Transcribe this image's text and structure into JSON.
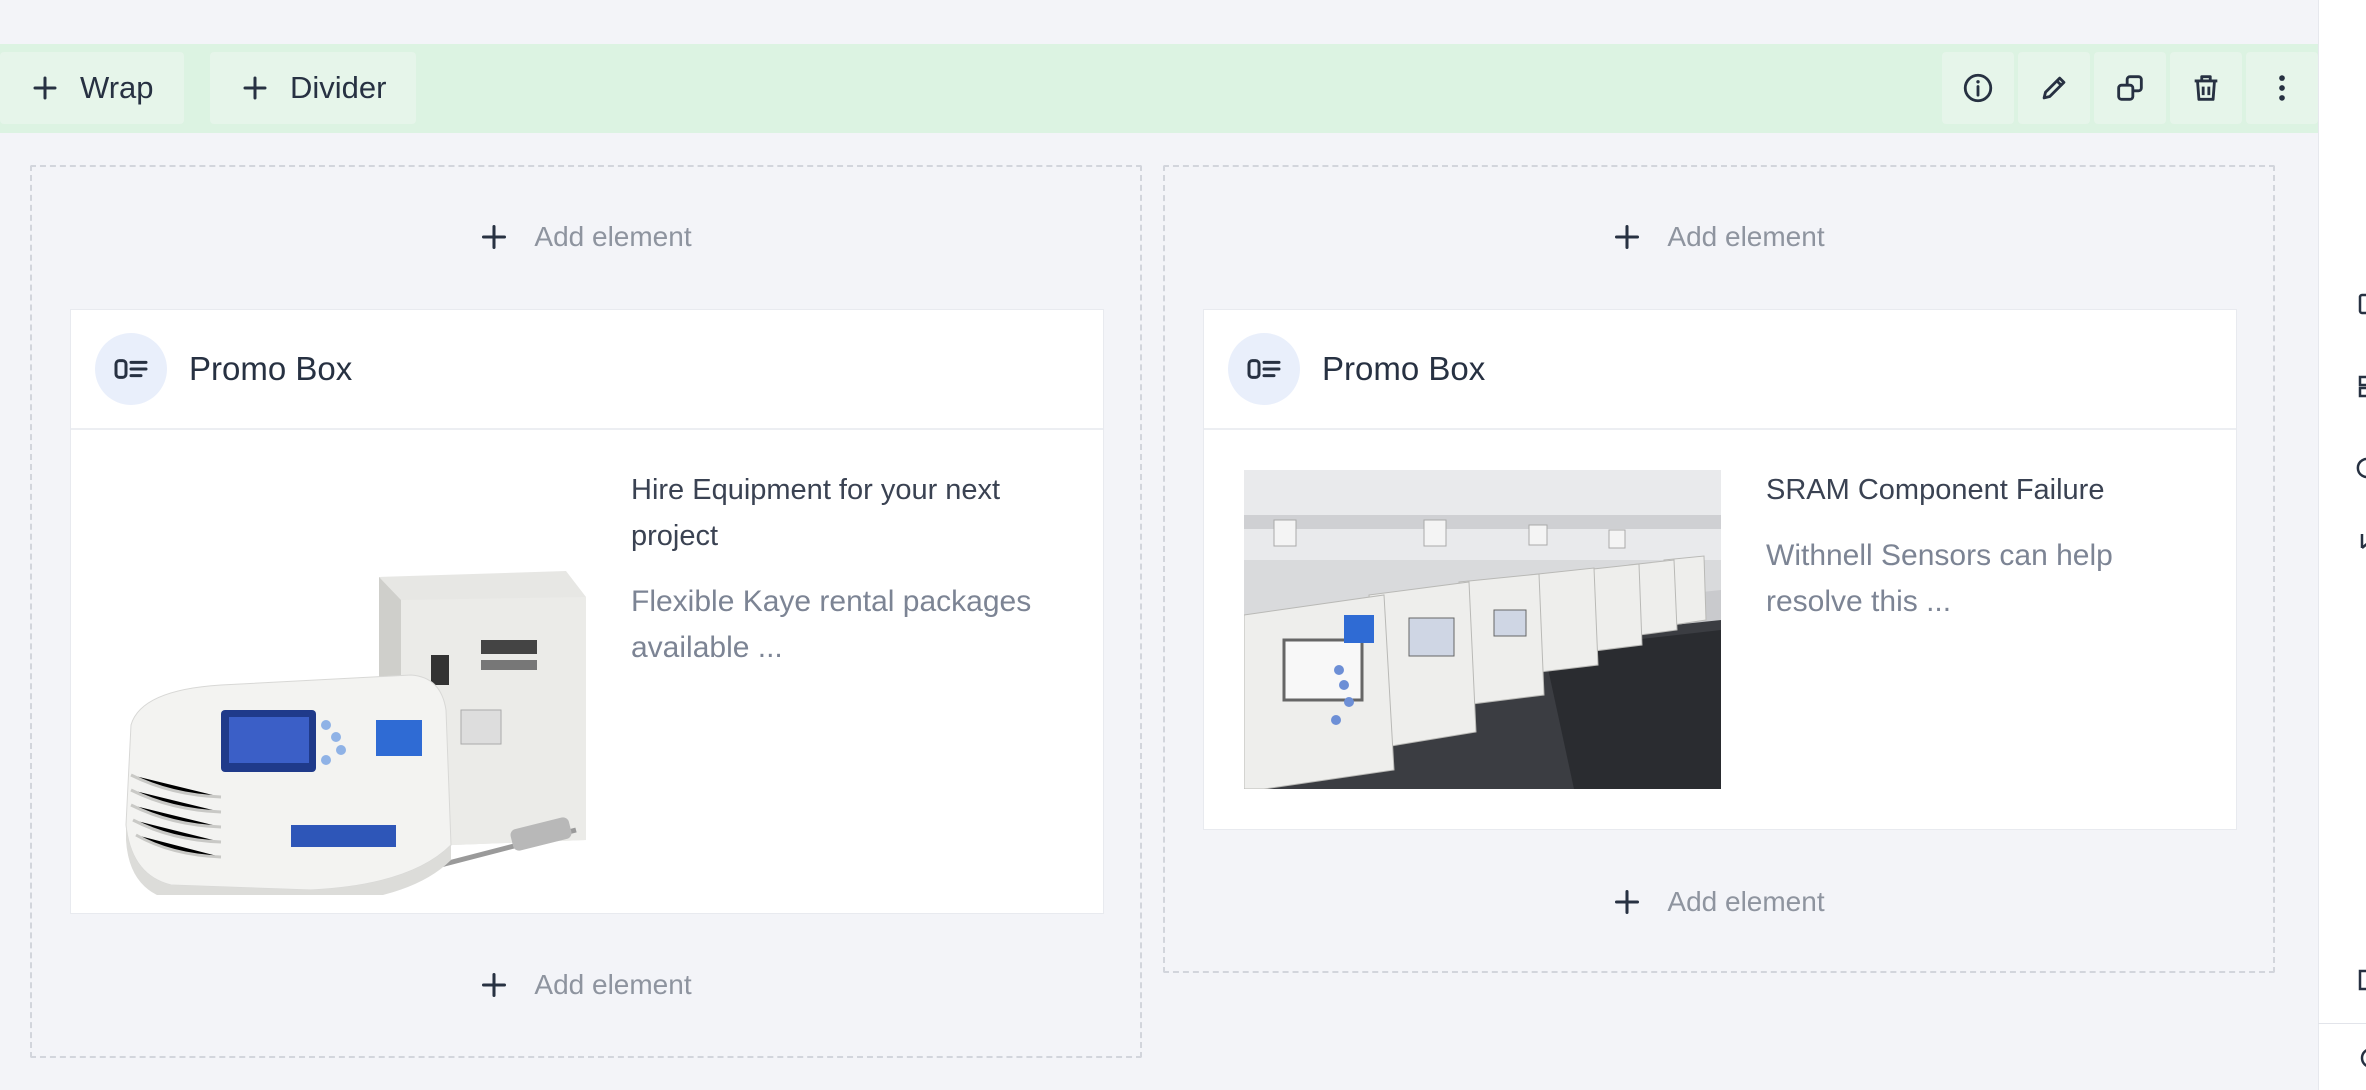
{
  "toolbar": {
    "wrap_label": "Wrap",
    "divider_label": "Divider",
    "tools": [
      "info-icon",
      "pencil-icon",
      "duplicate-icon",
      "trash-icon",
      "more-vertical-icon"
    ]
  },
  "columns": [
    {
      "add_top": "Add element",
      "add_bottom": "Add element",
      "promo": {
        "title": "Promo Box",
        "heading": "Hire Equipment for your next project",
        "description": "Flexible Kaye rental packages available ..."
      }
    },
    {
      "add_top": "Add element",
      "add_bottom": "Add element",
      "promo": {
        "title": "Promo Box",
        "heading": "SRAM Component Failure",
        "description": "Withnell Sensors can help resolve this ..."
      }
    }
  ],
  "colors": {
    "wrap_bar": "#dcf3e2",
    "canvas": "#f3f4f8",
    "text_primary": "#273142",
    "text_muted": "#8e949f"
  }
}
